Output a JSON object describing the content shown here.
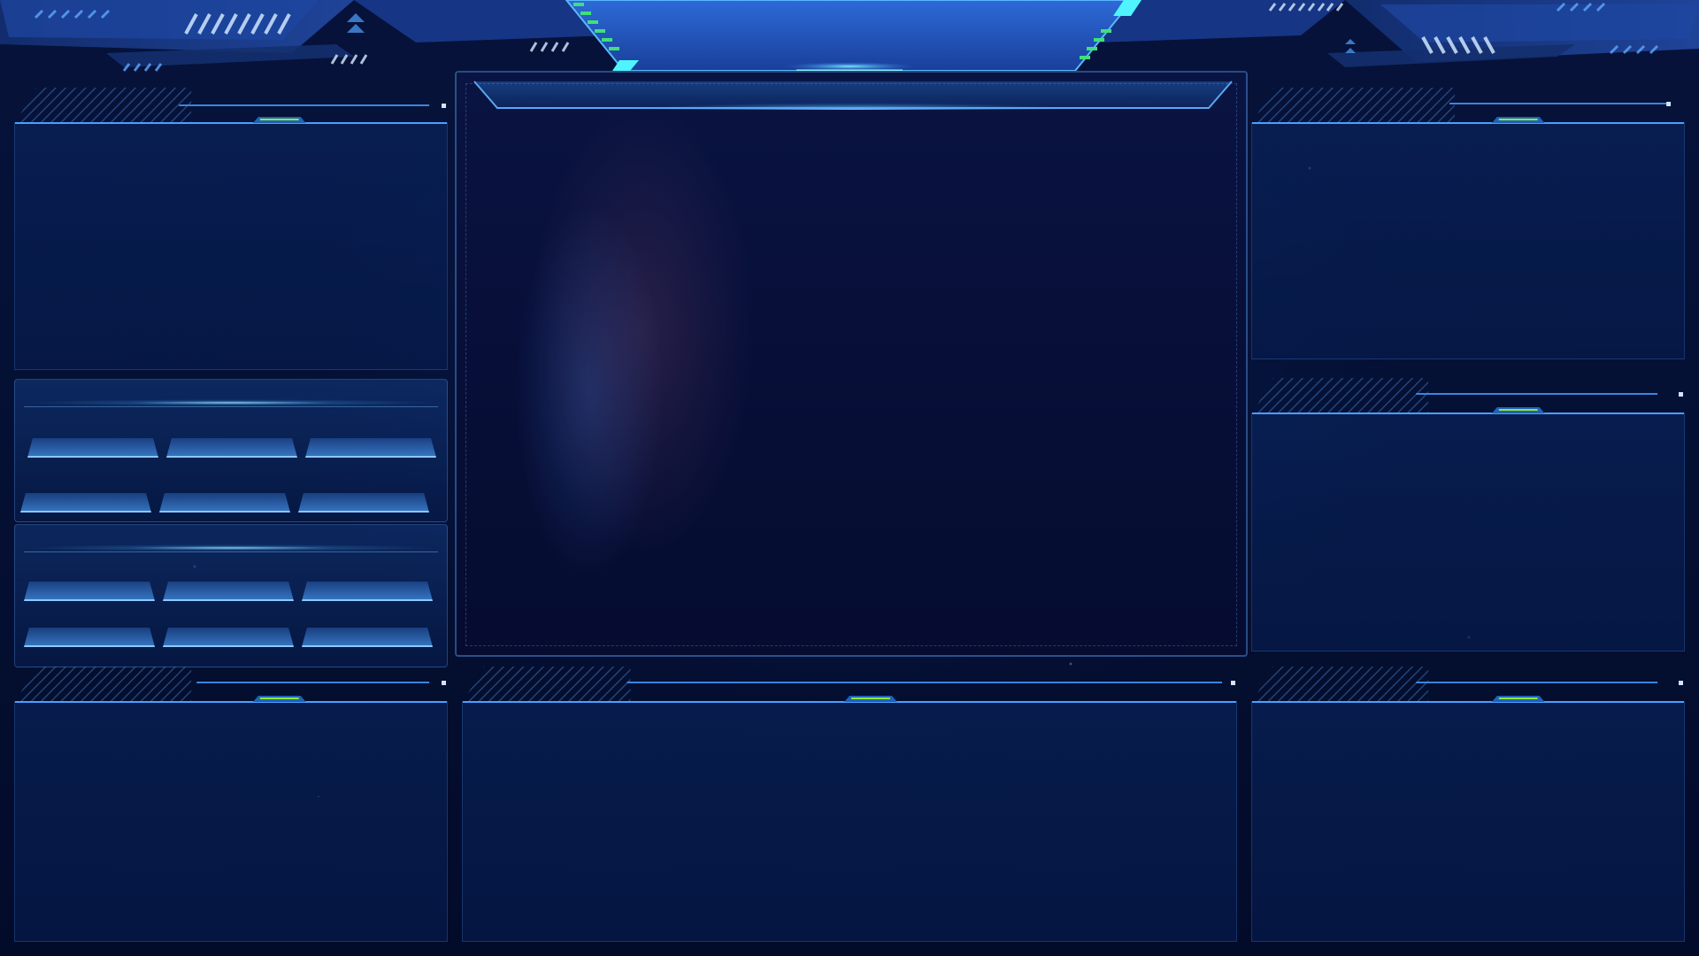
{
  "screen": {
    "accent_color": "#4fc8ff",
    "indicator_color": "#6fdc3a",
    "background_color": "#030a26"
  },
  "panels": [
    {
      "id": "left-top",
      "title": ""
    },
    {
      "id": "right-top",
      "title": ""
    },
    {
      "id": "right-middle",
      "title": ""
    },
    {
      "id": "left-bottom",
      "title": ""
    },
    {
      "id": "center-bottom",
      "title": ""
    },
    {
      "id": "right-bottom",
      "title": ""
    }
  ],
  "button_groups": [
    {
      "id": "group-1",
      "buttons": [
        "",
        "",
        "",
        "",
        "",
        ""
      ]
    },
    {
      "id": "group-2",
      "buttons": [
        "",
        "",
        "",
        "",
        "",
        ""
      ]
    }
  ],
  "icons": [
    "header-chevron-icon",
    "stripe-decoration-icon",
    "corner-dot-icon"
  ]
}
